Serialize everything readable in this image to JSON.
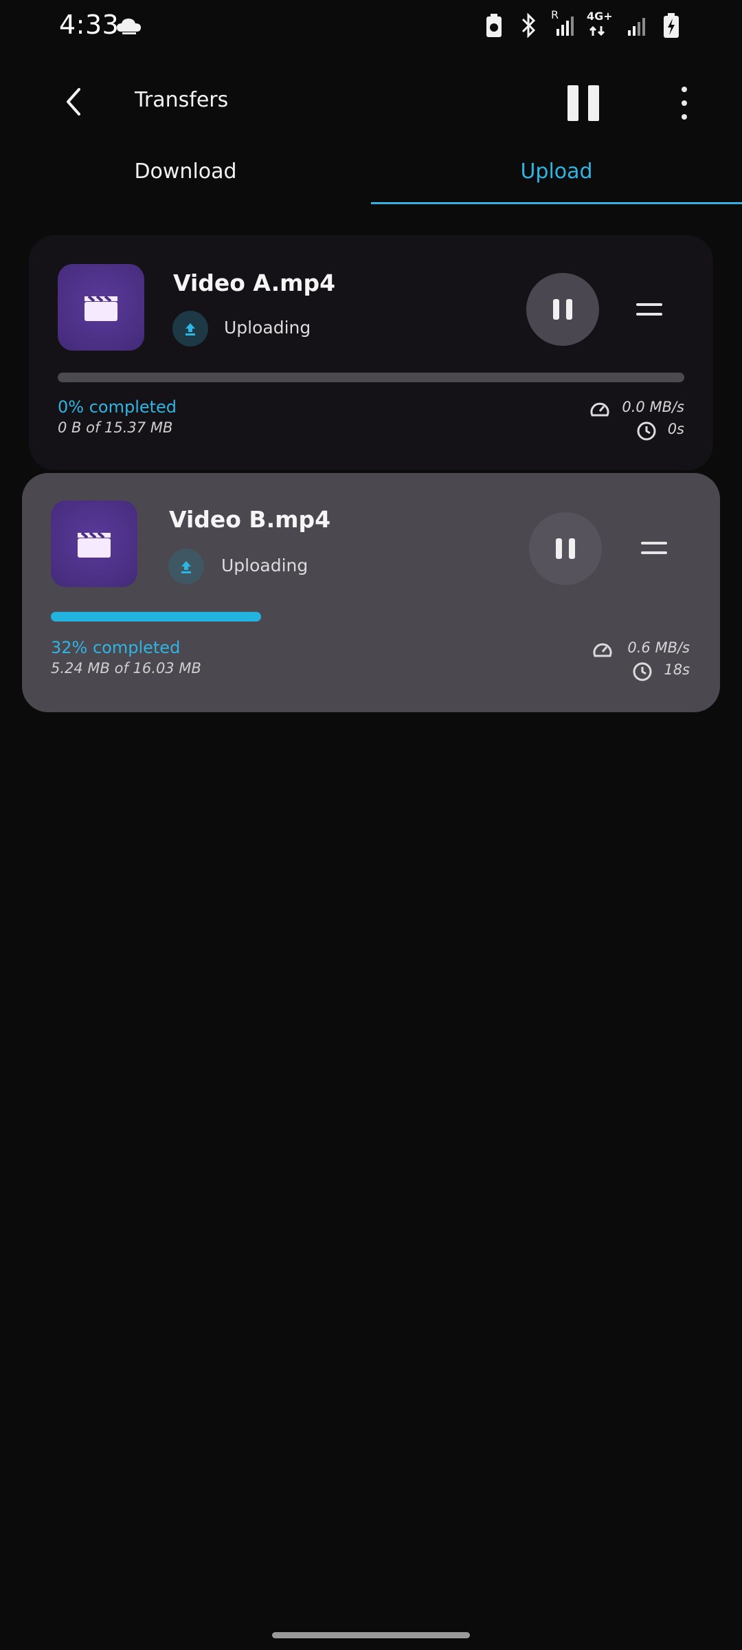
{
  "status_bar": {
    "time": "4:33",
    "icons": [
      "cloud-icon",
      "battery-saver-icon",
      "bluetooth-icon",
      "roaming-signal-icon",
      "4g-data-icon",
      "signal-icon",
      "battery-charging-icon"
    ],
    "network_label": "4G+",
    "roaming_label": "R"
  },
  "header": {
    "title": "Transfers",
    "icons": [
      "back-arrow-icon",
      "pause-all-icon",
      "more-vert-icon"
    ]
  },
  "tabs": [
    {
      "label": "Download",
      "active": false
    },
    {
      "label": "Upload",
      "active": true
    }
  ],
  "colors": {
    "accent": "#2fb5e3",
    "background": "#0b0b0b",
    "card_a_bg": "#141216",
    "card_b_bg": "#4b4850",
    "thumb": "#4a2f83"
  },
  "transfers": [
    {
      "name": "Video A.mp4",
      "status": "Uploading",
      "progress_pct": 0,
      "percent_label": "0% completed",
      "size_label": "0 B of 15.37 MB",
      "speed": "0.0 MB/s",
      "eta": "0s",
      "icons": [
        "video-file-icon",
        "upload-icon",
        "pause-icon",
        "drag-handle-icon",
        "speed-gauge-icon",
        "clock-icon"
      ]
    },
    {
      "name": "Video B.mp4",
      "status": "Uploading",
      "progress_pct": 32,
      "percent_label": "32% completed",
      "size_label": "5.24 MB of 16.03 MB",
      "speed": "0.6 MB/s",
      "eta": "18s",
      "icons": [
        "video-file-icon",
        "upload-icon",
        "pause-icon",
        "drag-handle-icon",
        "speed-gauge-icon",
        "clock-icon"
      ]
    }
  ]
}
